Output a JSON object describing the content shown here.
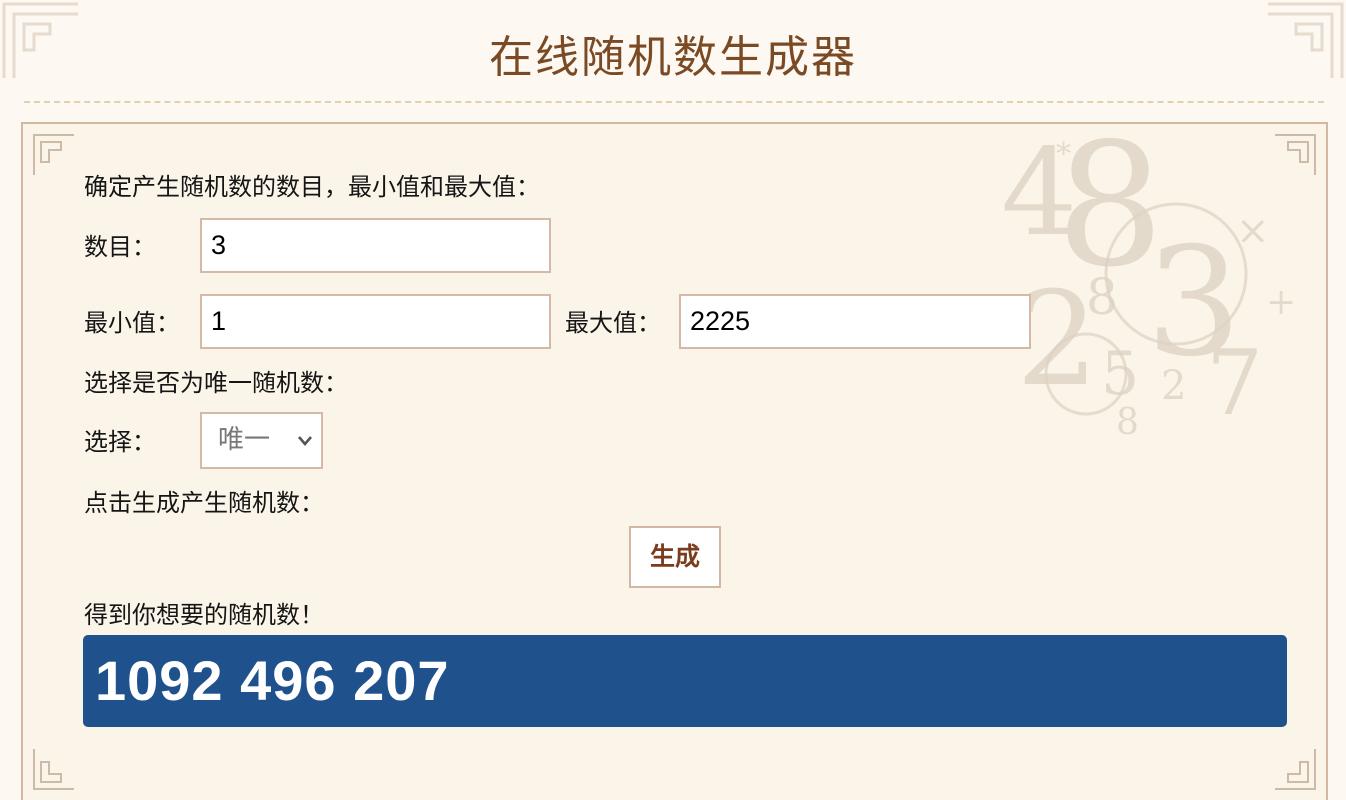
{
  "page": {
    "title": "在线随机数生成器"
  },
  "form": {
    "intro": "确定产生随机数的数目，最小值和最大值：",
    "count_label": "数目：",
    "count_value": "3",
    "min_label": "最小值：",
    "min_value": "1",
    "max_label": "最大值：",
    "max_value": "2225",
    "unique_prompt": "选择是否为唯一随机数：",
    "select_label": "选择：",
    "select_value": "唯一",
    "click_prompt": "点击生成产生随机数：",
    "generate_label": "生成",
    "result_prompt": "得到你想要的随机数！"
  },
  "result": {
    "numbers": "1092 496 207"
  },
  "colors": {
    "title": "#7a4a24",
    "panel_bg": "#fbf4e8",
    "panel_border": "#d3b8a2",
    "result_bg": "#1f528c",
    "button_text": "#7a3c1c"
  },
  "icons": {
    "corner": "ornament-corner-icon",
    "dropdown": "chevron-down-icon",
    "background": "numbers-decoration-icon"
  }
}
